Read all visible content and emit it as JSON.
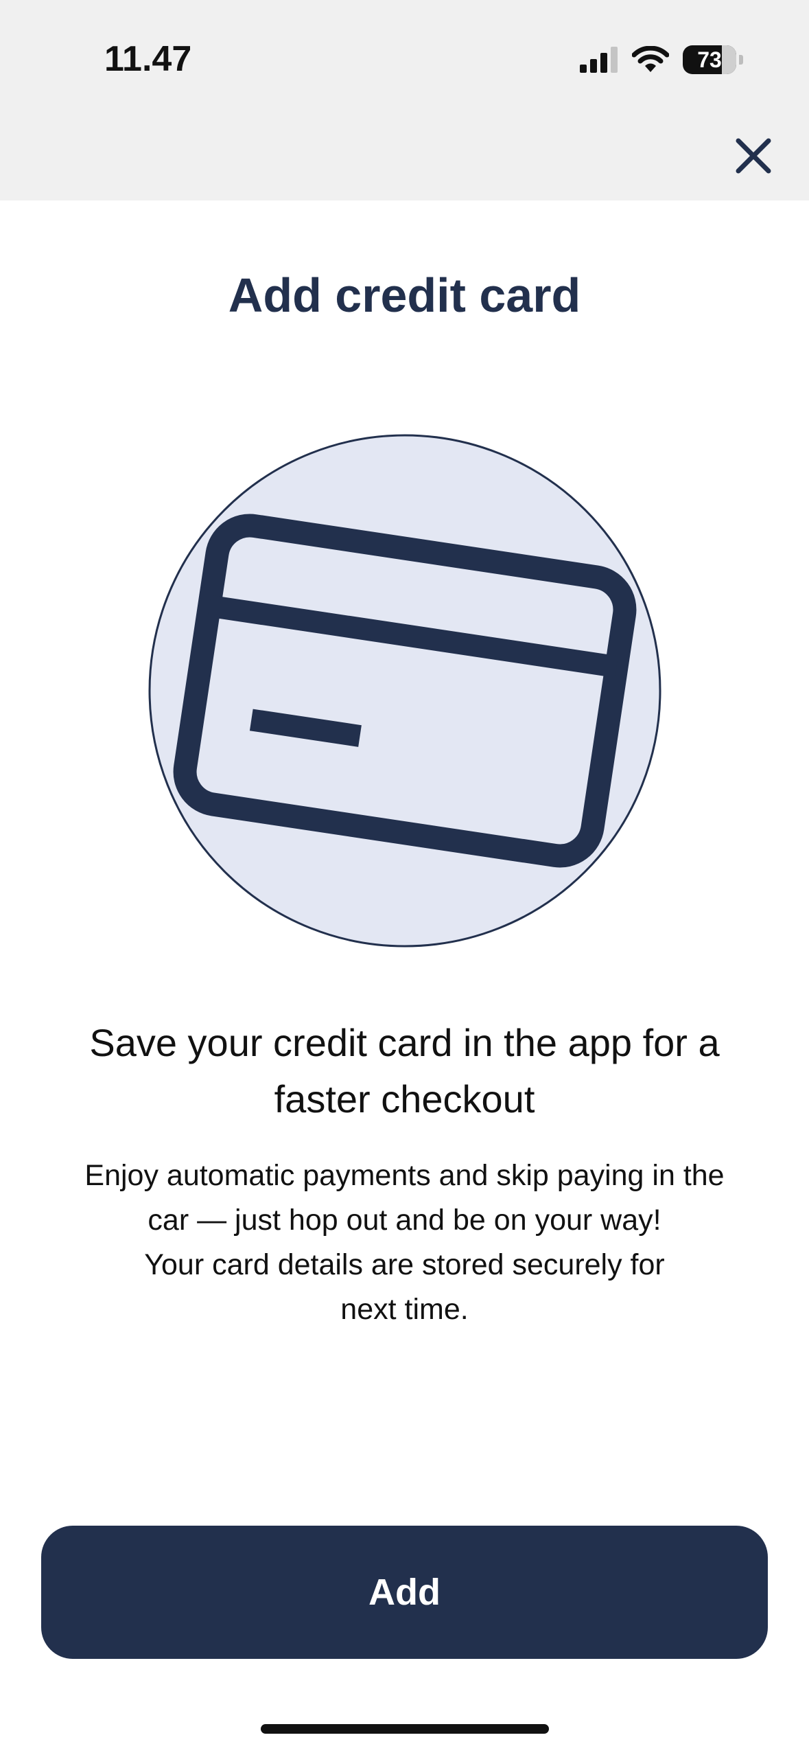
{
  "status_bar": {
    "time": "11.47",
    "battery_level": "73",
    "battery_fraction": 0.73,
    "icons": [
      "cellular-signal-icon",
      "wifi-icon",
      "battery-icon"
    ]
  },
  "header": {
    "close_icon": "close-icon"
  },
  "main": {
    "title": "Add credit card",
    "illustration_icon": "credit-card-icon",
    "headline": "Save your credit card in the app for a faster checkout",
    "body_lines": [
      "Enjoy automatic payments and skip paying in the",
      "car — just hop out and be on your way!",
      "Your card details are stored securely for",
      "next time."
    ]
  },
  "actions": {
    "add_label": "Add"
  },
  "colors": {
    "accent": "#22304d",
    "illustration_fill": "#e3e7f3",
    "top_background": "#f0f0f0"
  }
}
